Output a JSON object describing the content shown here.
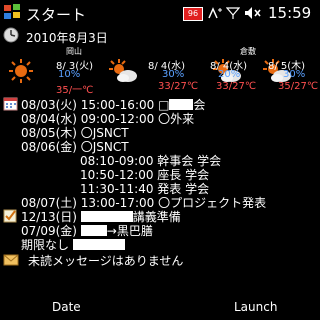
{
  "status_bar": {
    "app_title": "スタート",
    "time": "15:59",
    "battery_badge": "96"
  },
  "today": {
    "date": "2010年8月3日"
  },
  "weather": [
    {
      "location": "岡山",
      "date": "8/ 3(火)",
      "rain_chance": "10%",
      "temp": "35/一℃",
      "icon": "sun-icon"
    },
    {
      "location": "",
      "date": "8/ 4(水)",
      "rain_chance": "30%",
      "temp": "33/27℃",
      "icon": "sun-cloud-icon"
    },
    {
      "location": "倉敷",
      "date": "8/ 4(水)",
      "rain_chance": "20%",
      "temp": "33/27℃",
      "icon": "sun-cloud-icon"
    },
    {
      "location": "",
      "date": "8/ 5(木)",
      "rain_chance": "30%",
      "temp": "35/27℃",
      "icon": "sun-cloud-icon"
    }
  ],
  "schedule": [
    {
      "text": "08/03(火) 15:00-16:00 □",
      "suffix": "会",
      "redacted": true
    },
    {
      "text": "08/04(水) 09:00-12:00 〇外来",
      "suffix": "",
      "redacted": false
    },
    {
      "text": "08/05(木) 〇JSNCT",
      "suffix": "",
      "redacted": false
    },
    {
      "text": "08/06(金) 〇JSNCT",
      "suffix": "",
      "redacted": false
    },
    {
      "text": "08:10-09:00 幹事会 学会",
      "suffix": "",
      "redacted": false
    },
    {
      "text": "10:50-12:00 座長 学会",
      "suffix": "",
      "redacted": false
    },
    {
      "text": "11:30-11:40 発表 学会",
      "suffix": "",
      "redacted": false
    },
    {
      "text": "08/07(土) 13:00-17:00 〇プロジェクト発表",
      "suffix": "",
      "redacted": false
    }
  ],
  "tasks": [
    {
      "text": "12/13(日) ",
      "suffix": "講義準備"
    },
    {
      "text": "07/09(金) ",
      "suffix": "→黒巴膳"
    },
    {
      "text": "期限なし ",
      "suffix": ""
    }
  ],
  "messages": {
    "text": "未読メッセージはありません"
  },
  "softkeys": {
    "left": "Date",
    "right": "Launch"
  }
}
